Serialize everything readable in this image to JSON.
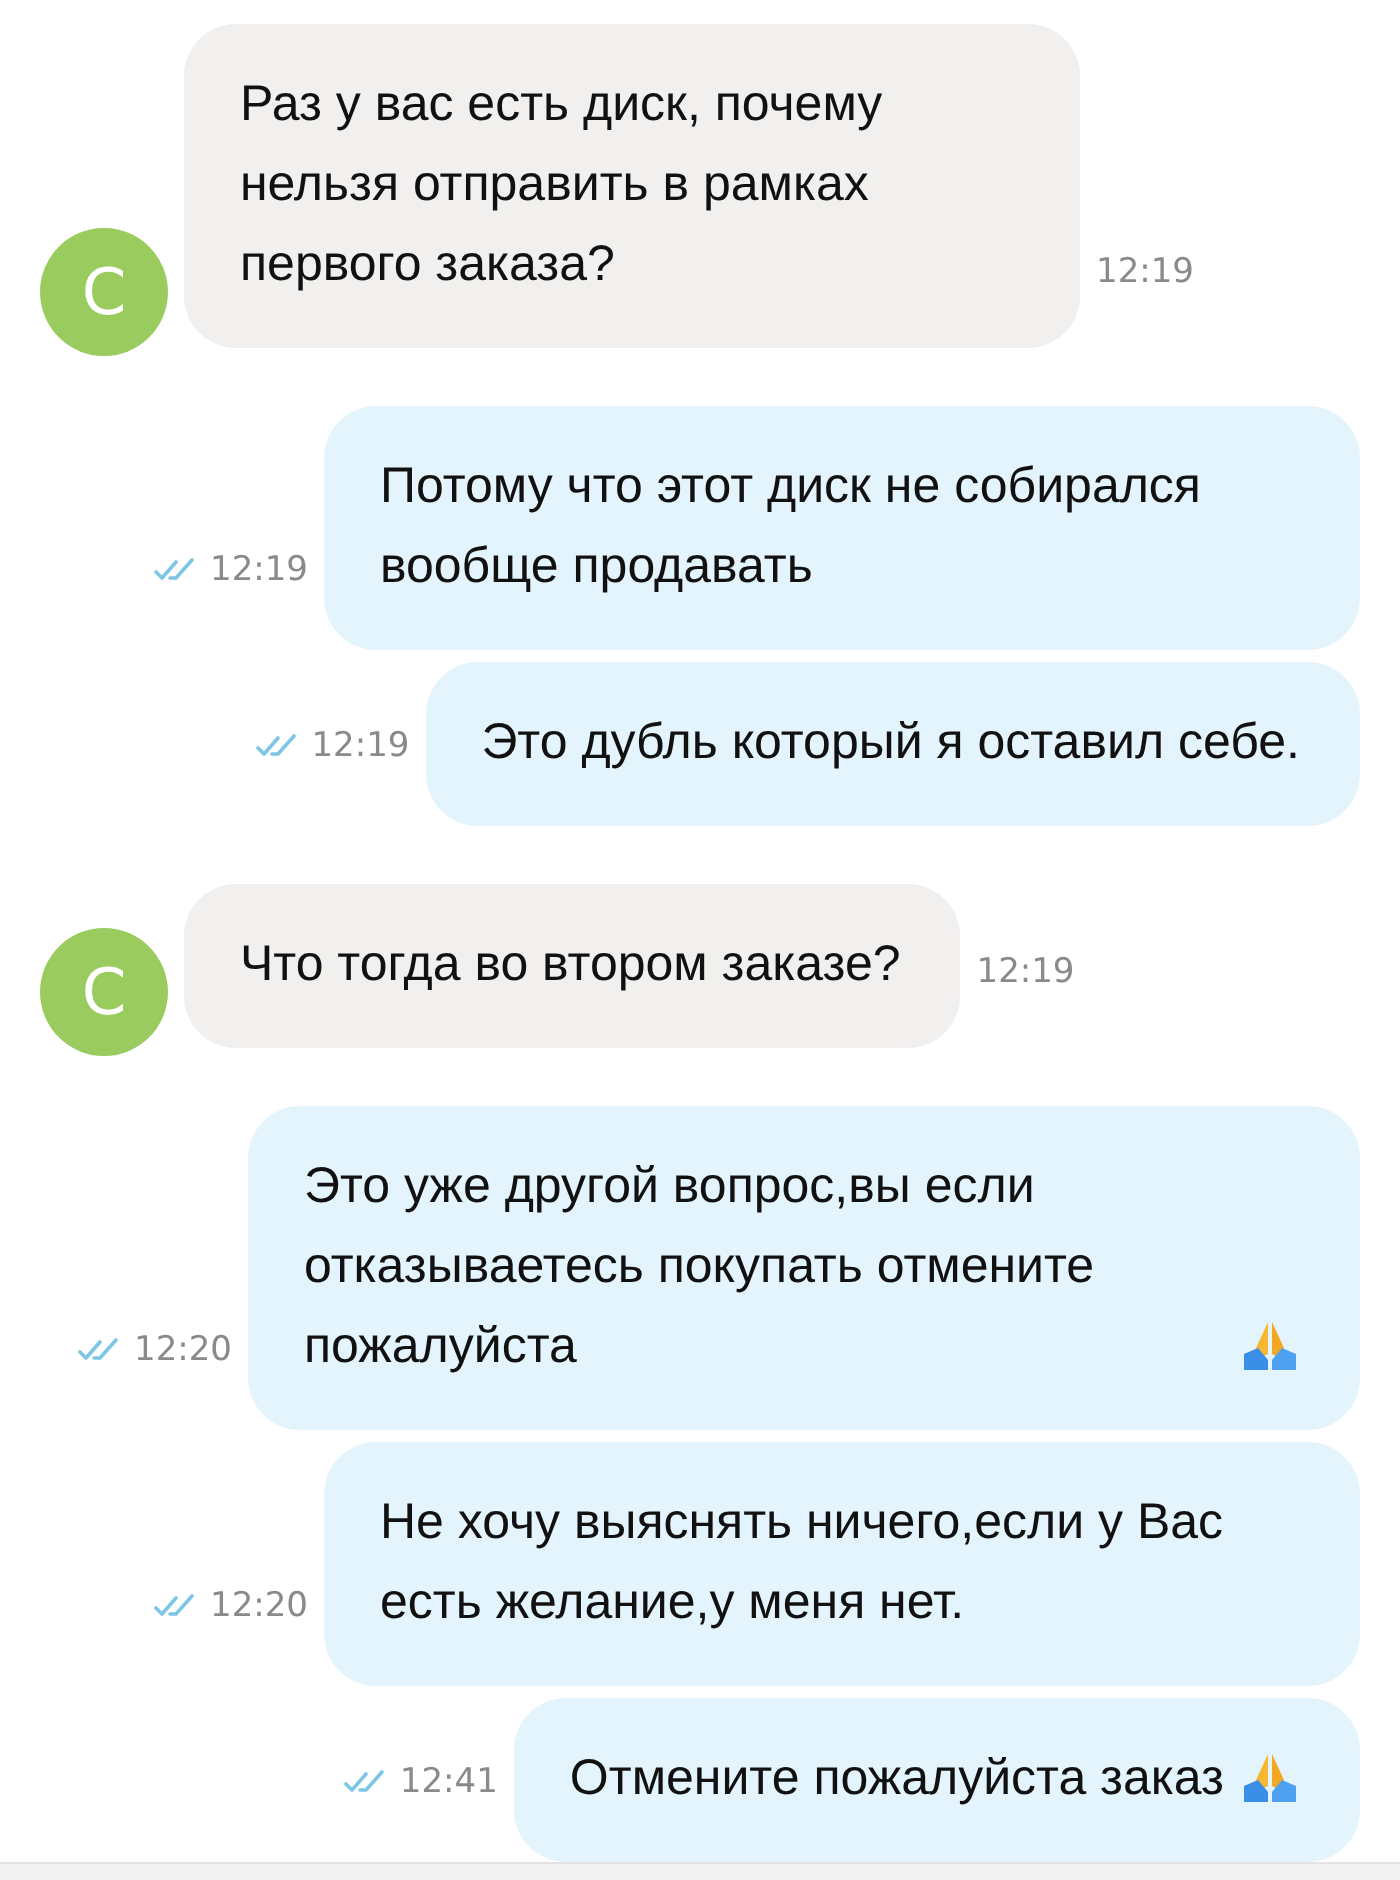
{
  "messages": [
    {
      "kind": "incoming",
      "avatar": "С",
      "text": "Раз у вас есть диск, почему нельзя отправить в рамках первого заказа?",
      "time": "12:19"
    },
    {
      "kind": "outgoing",
      "text": "Потому что этот диск не собирался вообще продавать",
      "time": "12:19"
    },
    {
      "kind": "outgoing",
      "text": "Это дубль который я оставил себе.",
      "time": "12:19"
    },
    {
      "kind": "incoming",
      "avatar": "С",
      "text": "Что тогда во втором заказе?",
      "time": "12:19"
    },
    {
      "kind": "outgoing",
      "text": "Это уже другой вопрос,вы если отказываетесь покупать отмените пожалуйста",
      "praying_hands": true,
      "time": "12:20"
    },
    {
      "kind": "outgoing",
      "text": "Не хочу выяснять ничего,если у Вас есть желание,у меня нет.",
      "time": "12:20"
    },
    {
      "kind": "outgoing",
      "text": "Отмените пожалуйста заказ",
      "praying_hands": true,
      "time": "12:41"
    }
  ]
}
